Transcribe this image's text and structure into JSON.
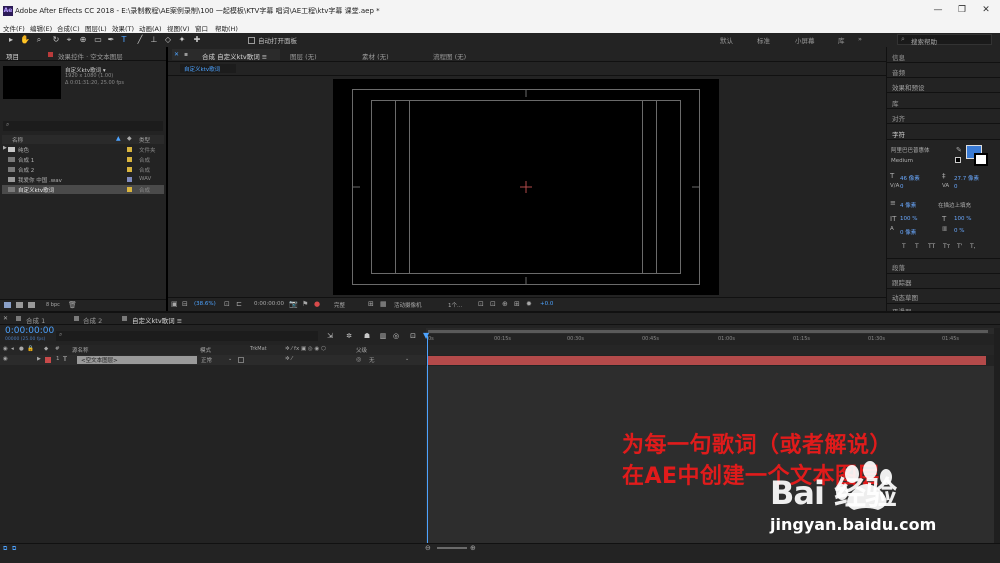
{
  "window": {
    "title": "Adobe After Effects CC 2018 - E:\\录制教程\\AE案例录制\\100 一起模板\\KTV字幕 唱词\\AE工程\\ktv字幕 课堂.aep *",
    "logo": "Ae",
    "minimize": "—",
    "maximize": "❐",
    "close": "✕"
  },
  "menu": [
    "文件(F)",
    "编辑(E)",
    "合成(C)",
    "图层(L)",
    "效果(T)",
    "动画(A)",
    "视图(V)",
    "窗口",
    "帮助(H)"
  ],
  "toolbar": {
    "auto_open_panel": "自动打开面板",
    "workspaces": [
      "默认",
      "标准",
      "小屏幕",
      "库"
    ],
    "search_help": "搜索帮助"
  },
  "project": {
    "tabs": [
      "项目",
      "效果控件 · 空文本图层"
    ],
    "selected_name": "自定义ktv歌词 ▾",
    "info": [
      "1920 x 1080 (1.00)",
      "Δ 0:01:31:20, 25.00 fps"
    ],
    "columns": {
      "name": "名称",
      "type": "类型"
    },
    "rows": [
      {
        "name": "纯色",
        "type": "文件夹",
        "color": "#d9b53e",
        "folder": true
      },
      {
        "name": "合成 1",
        "type": "合成",
        "color": "#d9b53e",
        "folder": false
      },
      {
        "name": "合成 2",
        "type": "合成",
        "color": "#d9b53e",
        "folder": false
      },
      {
        "name": "我爱你 中国 .wav",
        "type": "WAV",
        "color": "#7f8bbf",
        "folder": false
      },
      {
        "name": "自定义ktv歌词",
        "type": "合成",
        "color": "#d9b53e",
        "folder": false
      }
    ],
    "footer_bpc": "8 bpc"
  },
  "viewer": {
    "tabs": [
      "合成 自定义ktv歌词 ≡",
      "图层 (无)",
      "素材 (无)",
      "流程图 (无)"
    ],
    "subtab": "自定义ktv歌词",
    "zoom": "(38.6%)",
    "time": "0:00:00:00",
    "quality": "完整",
    "camera": "活动摄像机",
    "views": "1个...",
    "offset": "+0.0"
  },
  "right_panel": {
    "items": [
      "信息",
      "音频",
      "效果和预设",
      "库",
      "对齐",
      "字符"
    ],
    "character": {
      "font": "阿里巴巴普惠体",
      "style": "Medium",
      "size": "46 像素",
      "leading": "27.7 像素",
      "kerning": "0",
      "tracking": "0",
      "stroke": "4 像素",
      "stroke_mode": "在描边上填充",
      "vscale": "100 %",
      "hscale": "100 %",
      "baseline": "0 像素",
      "tsume": "0 %",
      "styles": [
        "T",
        "T",
        "TT",
        "Tт",
        "T'",
        "T,"
      ]
    },
    "bottom_items": [
      "段落",
      "跟踪器",
      "动态草图",
      "平滑器"
    ]
  },
  "timeline": {
    "tabs": [
      "合成 1",
      "合成 2",
      "自定义ktv歌词 ≡"
    ],
    "timecode": "0:00:00:00",
    "timecode_sub": "00000 (25.00 fps)",
    "columns": {
      "num": "#",
      "source": "源名称",
      "mode": "模式",
      "trkmat": "TrkMat",
      "parent": "父级"
    },
    "layer": {
      "num": "1",
      "type": "T",
      "name": "<空文本图层>",
      "mode": "正常",
      "parent": "无"
    },
    "ruler": [
      "0s",
      "00:15s",
      "00:30s",
      "00:45s",
      "01:00s",
      "01:15s",
      "01:30s",
      "01:45s"
    ]
  },
  "overlay": {
    "caption_line1": "为每一句歌词（或者解说）",
    "caption_line2": "在AE中创建一个文本图层",
    "watermark_brand": "Bai 经验",
    "watermark_url": "jingyan.baidu.com"
  }
}
